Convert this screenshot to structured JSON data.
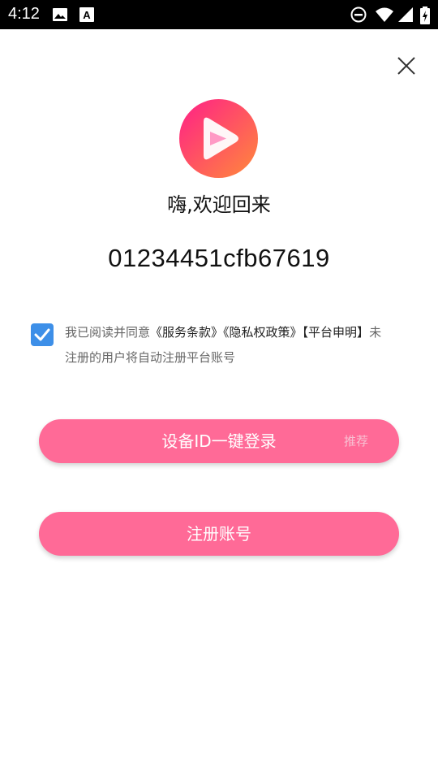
{
  "status_bar": {
    "time": "4:12",
    "icons": [
      "image-icon",
      "a-font-icon",
      "do-not-disturb-icon",
      "wifi-icon",
      "signal-icon",
      "battery-icon"
    ]
  },
  "close_icon": "close-icon",
  "logo_icon": "play-logo-icon",
  "welcome": "嗨,欢迎回来",
  "device_id": "01234451cfb67619",
  "agreement": {
    "checked": true,
    "prefix": "我已阅读并同意",
    "terms": "《服务条款》",
    "privacy": "《隐私权政策》",
    "platform": "【平台申明】",
    "suffix": "未注册的用户将自动注册平台账号"
  },
  "buttons": {
    "login_label": "设备ID一键登录",
    "recommend_tag": "推荐",
    "register_label": "注册账号"
  },
  "colors": {
    "primary_button": "#ff6a97",
    "checkbox": "#3d8fe8",
    "logo_gradient_start": "#ff2b86",
    "logo_gradient_end": "#ff8a3d"
  }
}
